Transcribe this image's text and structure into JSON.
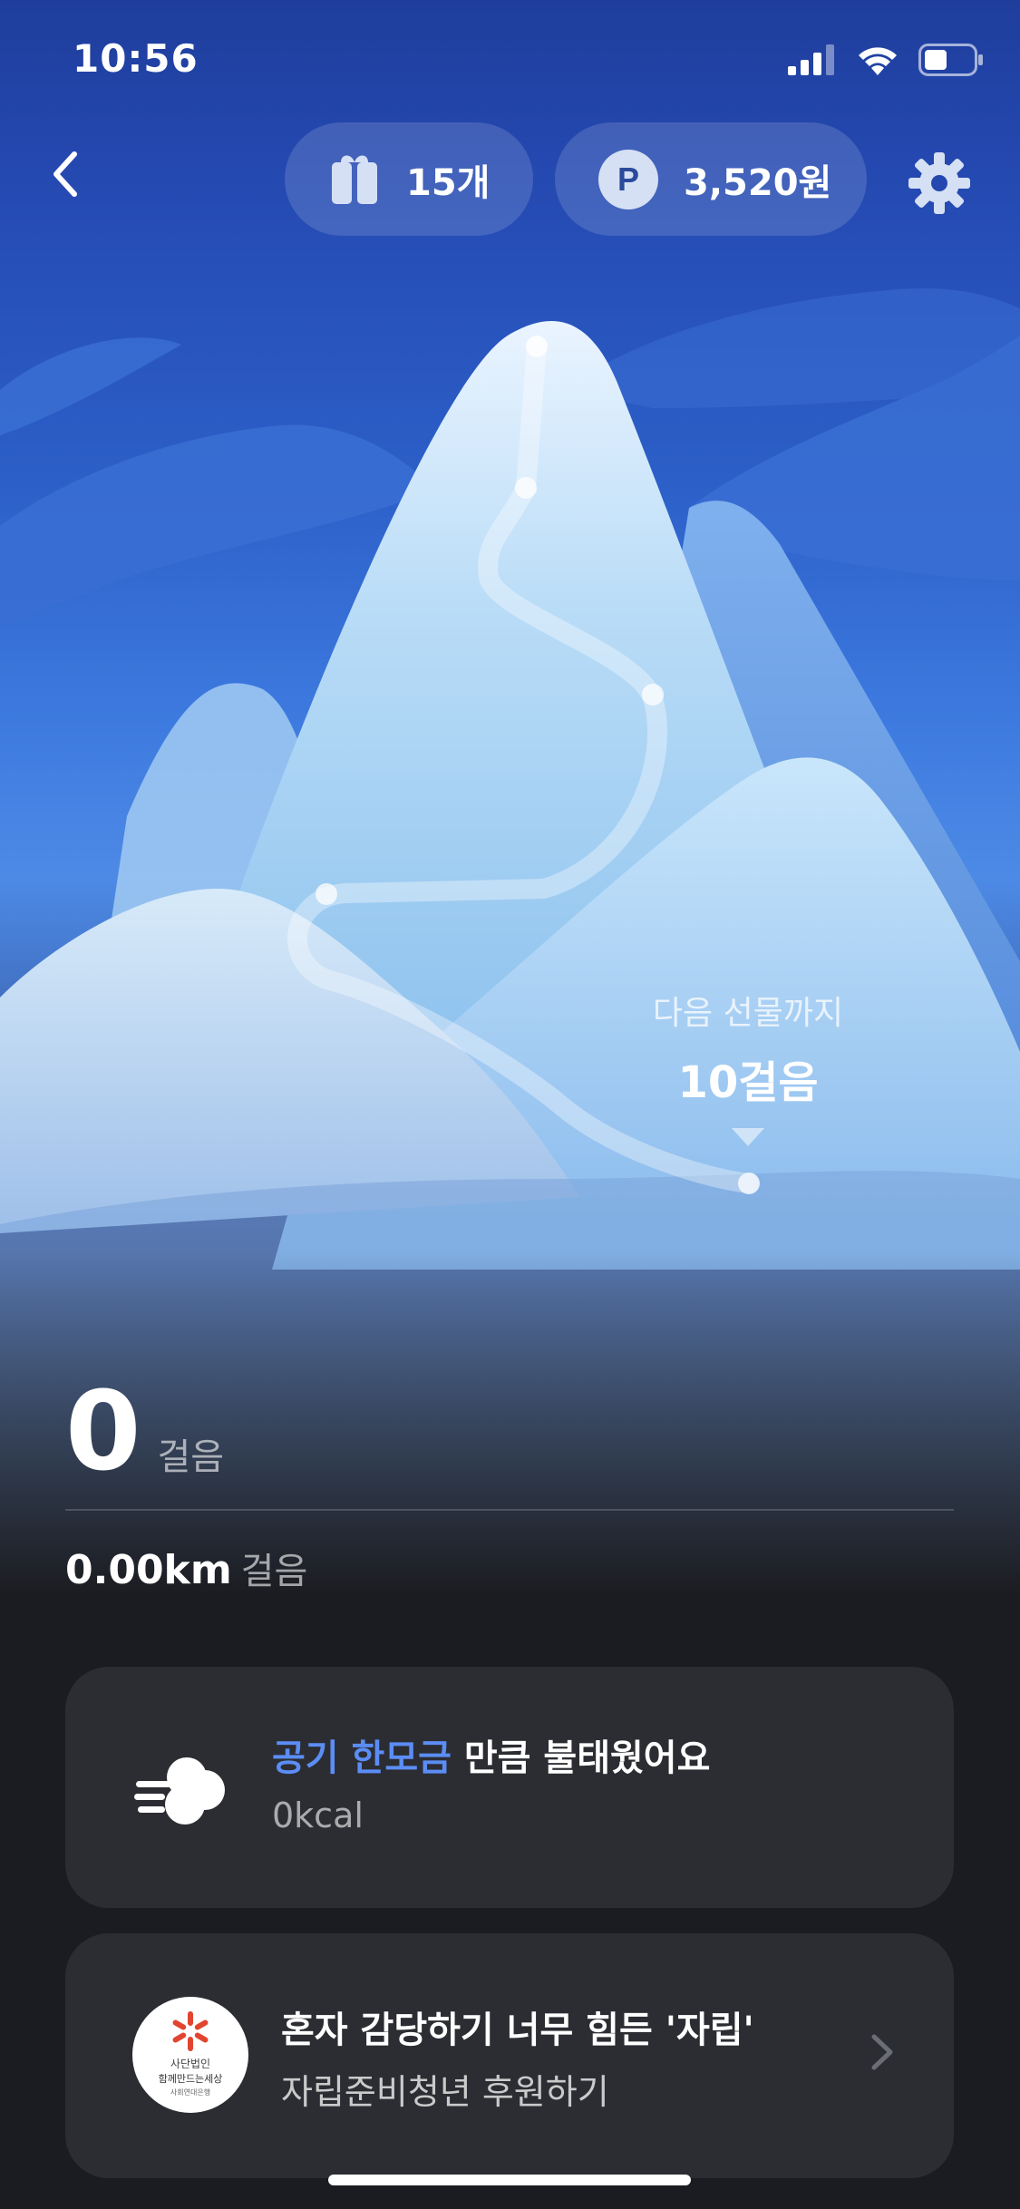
{
  "status_bar": {
    "time": "10:56"
  },
  "header": {
    "gift_count": "15개",
    "points": "3,520원",
    "back_icon": "chevron-left-icon",
    "gift_icon": "gift-box-icon",
    "points_icon": "point-p-icon",
    "settings_icon": "gear-icon"
  },
  "mountain": {
    "next_gift_label": "다음 선물까지",
    "next_gift_steps": "10걸음"
  },
  "stats": {
    "steps_value": "0",
    "steps_unit": "걸음",
    "distance_value": "0.00km",
    "distance_unit": "걸음"
  },
  "calorie_card": {
    "highlight": "공기 한모금",
    "rest": " 만큼 불태웠어요",
    "kcal": "0kcal",
    "icon": "cloud-wind-icon"
  },
  "donation_card": {
    "title": "혼자 감당하기 너무 힘든 '자립'",
    "subtitle": "자립준비청년 후원하기",
    "logo_text_1": "사단법인",
    "logo_text_2": "함께만드는세상",
    "logo_text_3": "사회연대은행",
    "logo_icon": "org-logo-icon",
    "chevron_icon": "chevron-right-icon"
  },
  "colors": {
    "accent": "#5b8df5",
    "card_bg": "#2c2d33",
    "page_bg": "#1b1c21",
    "sky_top": "#1f3e9c"
  }
}
